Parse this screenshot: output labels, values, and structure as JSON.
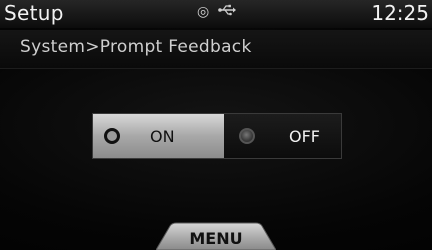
{
  "header": {
    "title": "Setup",
    "status_icons": [
      {
        "name": "disc-icon",
        "glyph": "◎"
      },
      {
        "name": "usb-icon",
        "glyph": "⭠"
      }
    ],
    "clock": "12:25"
  },
  "breadcrumb": "System>Prompt Feedback",
  "toggle": {
    "on_label": "ON",
    "off_label": "OFF",
    "selected": "ON"
  },
  "footer": {
    "menu_label": "MENU"
  },
  "colors": {
    "selected_option": "#b4b4b4",
    "unselected_option": "#141414",
    "background": "#000000"
  }
}
